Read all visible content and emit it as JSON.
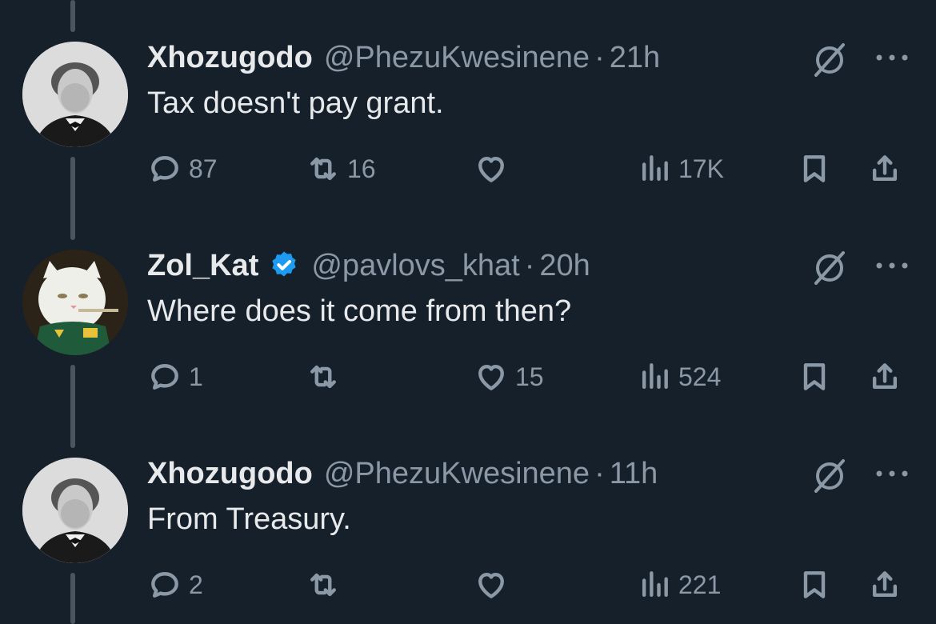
{
  "tweets": [
    {
      "display_name": "Xhozugodo",
      "handle": "@PhezuKwesinene",
      "separator": "·",
      "time": "21h",
      "verified": false,
      "avatar": "portrait-avatar",
      "text": "Tax doesn't pay grant.",
      "reply_count": "87",
      "repost_count": "16",
      "like_count": "",
      "view_count": "17K"
    },
    {
      "display_name": "Zol_Kat",
      "handle": "@pavlovs_khat",
      "separator": "·",
      "time": "20h",
      "verified": true,
      "avatar": "cat-avatar",
      "text": "Where does it come from then?",
      "reply_count": "1",
      "repost_count": "",
      "like_count": "15",
      "view_count": "524"
    },
    {
      "display_name": "Xhozugodo",
      "handle": "@PhezuKwesinene",
      "separator": "·",
      "time": "11h",
      "verified": false,
      "avatar": "portrait-avatar",
      "text": "From Treasury.",
      "reply_count": "2",
      "repost_count": "",
      "like_count": "",
      "view_count": "221"
    }
  ],
  "colors": {
    "background": "#15202b",
    "text": "#e7e9ea",
    "muted": "#8b98a5",
    "verified": "#1d9bf0",
    "thread_line": "#4a5561"
  },
  "icons": [
    "reply-icon",
    "repost-icon",
    "like-icon",
    "views-icon",
    "bookmark-icon",
    "share-icon",
    "grok-icon",
    "more-icon",
    "verified-badge-icon"
  ]
}
